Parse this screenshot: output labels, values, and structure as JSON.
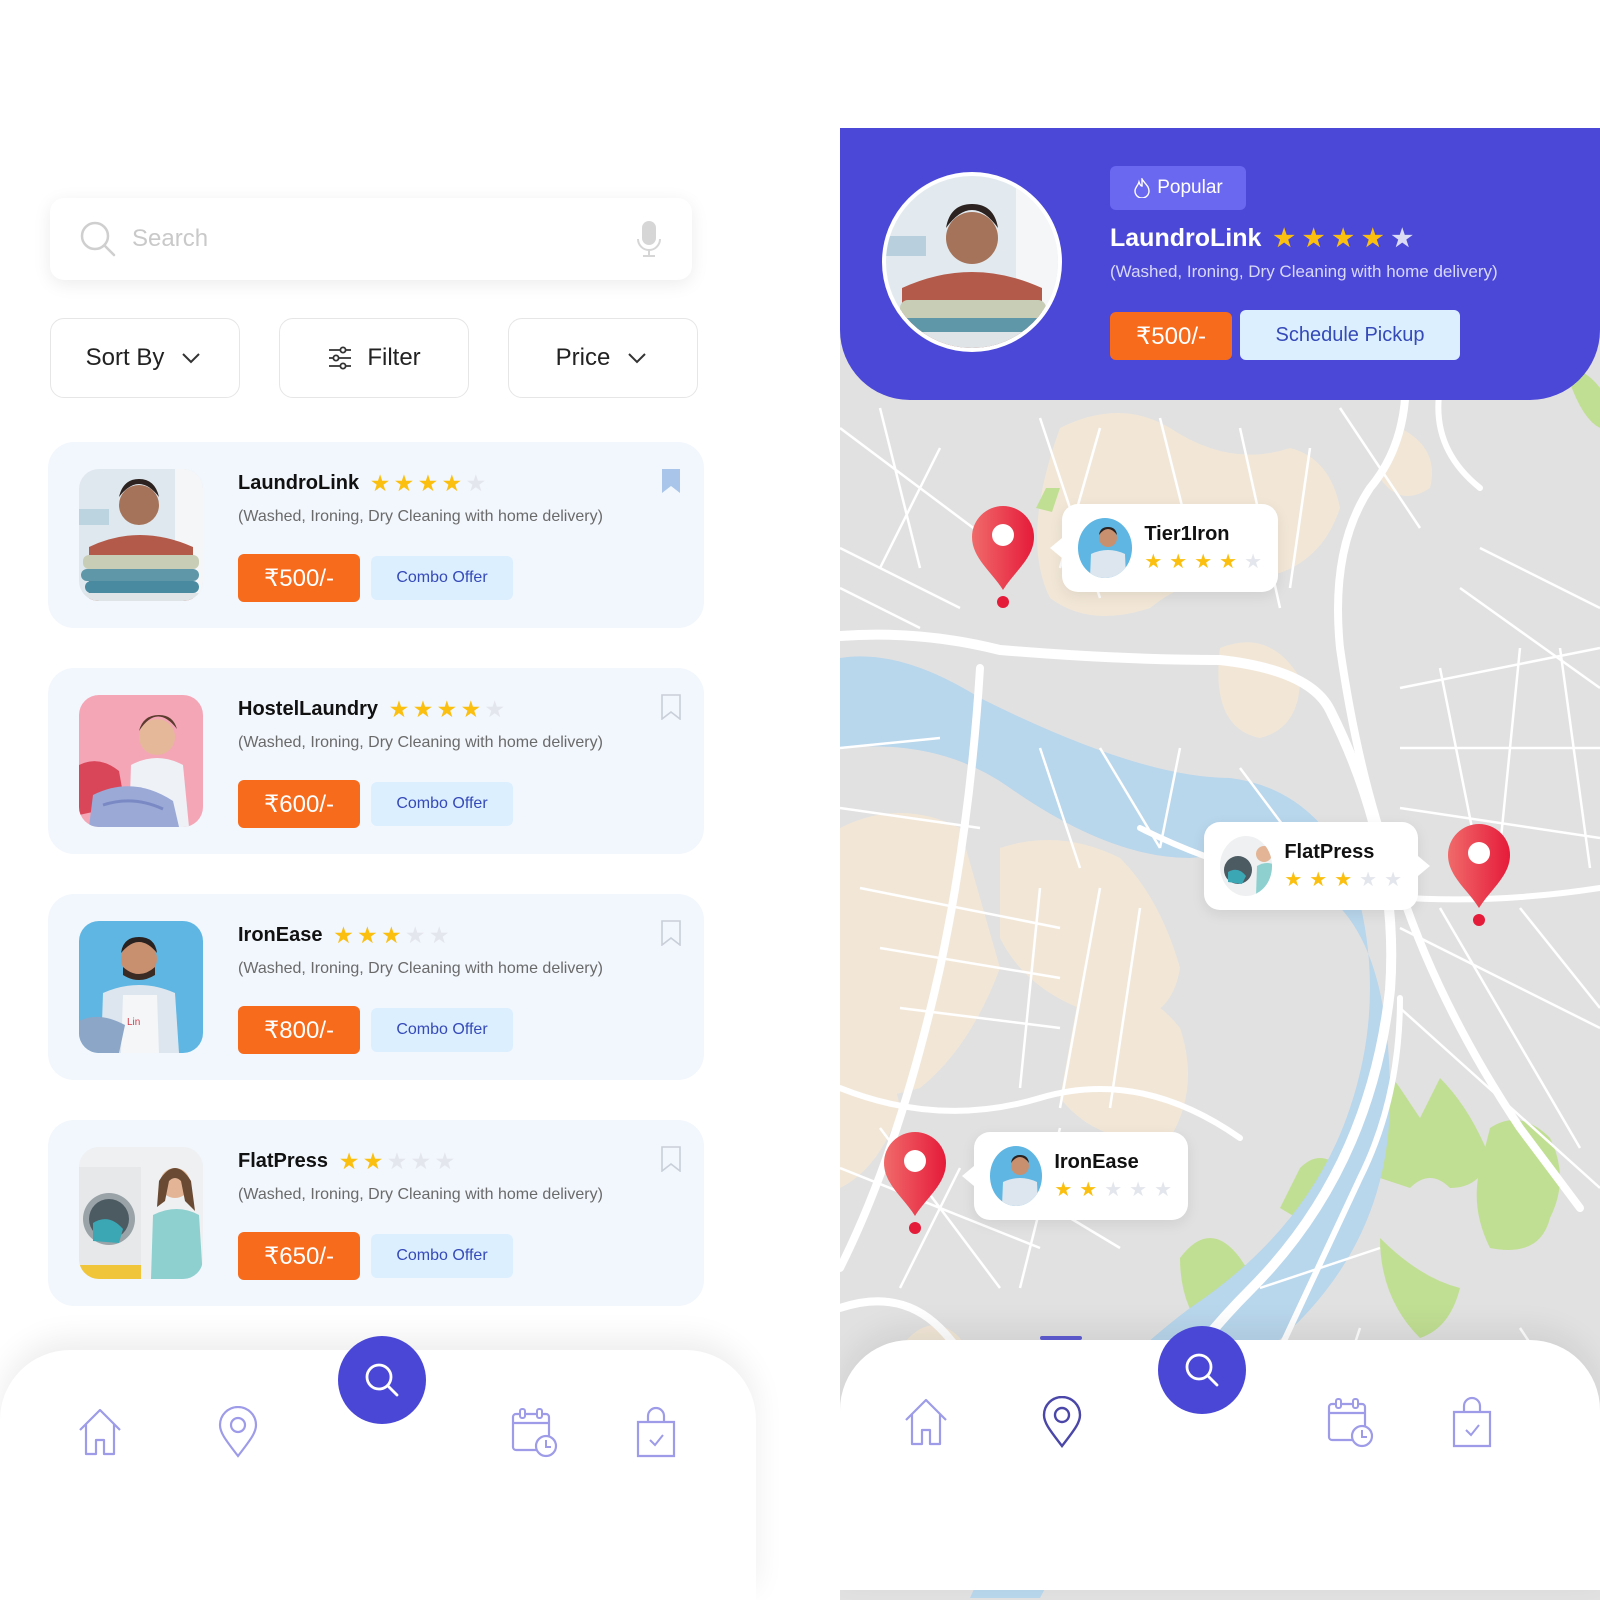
{
  "colors": {
    "primary": "#4b48d8",
    "price_orange": "#f76b1c",
    "combo_bg": "#dcefff",
    "star_on": "#fbbf0f",
    "star_off": "#e3e6ec",
    "card_bg": "#f2f7fd",
    "pin_red": "#e8323f"
  },
  "list_screen": {
    "search": {
      "placeholder": "Search",
      "icon": "search-icon",
      "mic_icon": "microphone-icon"
    },
    "filters": [
      {
        "label": "Sort By",
        "icon": "chevron-down-icon"
      },
      {
        "label": "Filter",
        "icon": "sliders-icon"
      },
      {
        "label": "Price",
        "icon": "chevron-down-icon"
      }
    ],
    "cards": [
      {
        "name": "LaundroLink",
        "rating": 4,
        "max_rating": 5,
        "description": "(Washed, Ironing, Dry Cleaning with home delivery)",
        "price": "₹500/-",
        "offer": "Combo Offer",
        "bookmarked": true
      },
      {
        "name": "HostelLaundry",
        "rating": 4,
        "max_rating": 5,
        "description": "(Washed, Ironing, Dry Cleaning with home delivery)",
        "price": "₹600/-",
        "offer": "Combo Offer",
        "bookmarked": false
      },
      {
        "name": "IronEase",
        "rating": 3,
        "max_rating": 5,
        "description": "(Washed, Ironing, Dry Cleaning with home delivery)",
        "price": "₹800/-",
        "offer": "Combo Offer",
        "bookmarked": false
      },
      {
        "name": "FlatPress",
        "rating": 2,
        "max_rating": 5,
        "description": "(Washed, Ironing, Dry Cleaning with home delivery)",
        "price": "₹650/-",
        "offer": "Combo Offer",
        "bookmarked": false
      }
    ],
    "nav": {
      "items": [
        "home",
        "location",
        "search",
        "schedule",
        "orders"
      ],
      "active": "search"
    }
  },
  "map_screen": {
    "featured": {
      "badge": "Popular",
      "badge_icon": "flame-icon",
      "name": "LaundroLink",
      "rating": 4,
      "max_rating": 5,
      "description": "(Washed, Ironing, Dry Cleaning with home delivery)",
      "price": "₹500/-",
      "action": "Schedule Pickup"
    },
    "markers": [
      {
        "name": "Tier1Iron",
        "rating": 4,
        "max_rating": 5
      },
      {
        "name": "FlatPress",
        "rating": 3,
        "max_rating": 5
      },
      {
        "name": "IronEase",
        "rating": 2,
        "max_rating": 5
      }
    ],
    "nav": {
      "items": [
        "home",
        "location",
        "search",
        "schedule",
        "orders"
      ],
      "active": "location"
    }
  }
}
